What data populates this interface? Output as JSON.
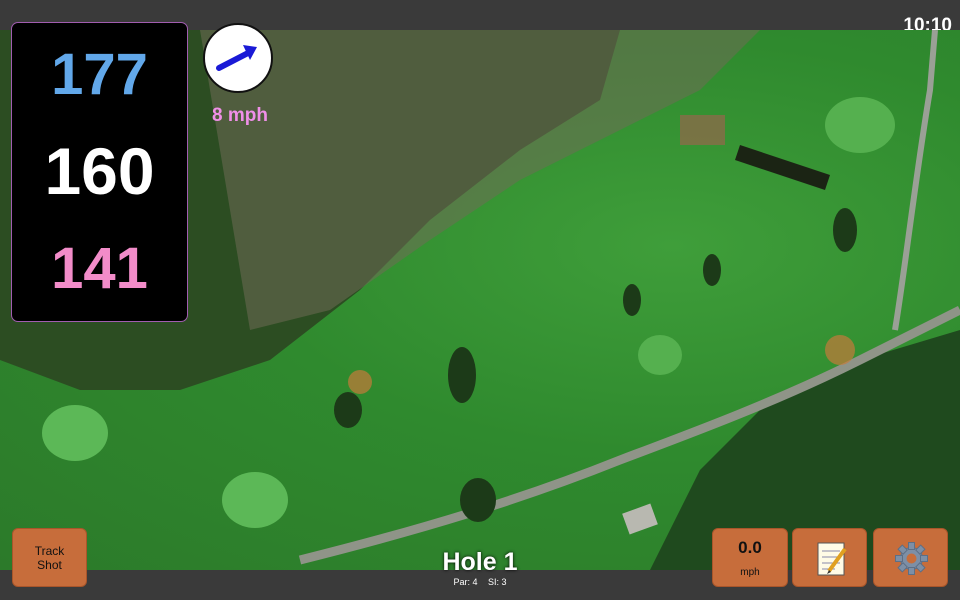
{
  "status": {
    "time": "10:10"
  },
  "distances": {
    "back": "177",
    "middle": "160",
    "front": "141"
  },
  "wind": {
    "speed_label": "8 mph",
    "icon": "wind-direction-arrow-icon"
  },
  "buttons": {
    "track_shot_line1": "Track",
    "track_shot_line2": "Shot",
    "wind_value": "0.0",
    "wind_unit": "mph",
    "notes_icon": "notepad-icon",
    "settings_icon": "gear-icon"
  },
  "hole": {
    "title": "Hole 1",
    "par_label": "Par: 4",
    "si_label": "SI: 3"
  },
  "colors": {
    "back": "#62a8ea",
    "middle": "#ffffff",
    "front": "#f28cc9",
    "button": "#c76d3b",
    "wind_text": "#f08fe8"
  }
}
